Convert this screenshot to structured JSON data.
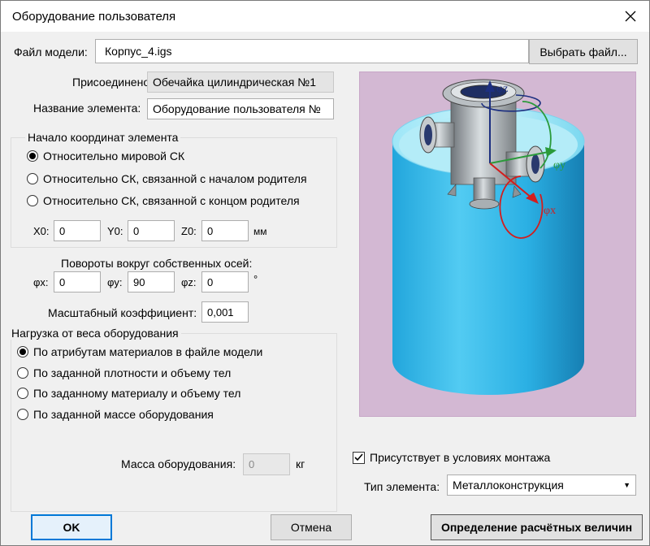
{
  "window": {
    "title": "Оборудование пользователя"
  },
  "model_file": {
    "label": "Файл модели:",
    "value": "Корпус_4.igs",
    "browse_button": "Выбрать файл..."
  },
  "attached_to": {
    "label": "Присоединено к:",
    "value": "Обечайка цилиндрическая №1"
  },
  "element_name": {
    "label": "Название элемента:",
    "value": "Оборудование пользователя №"
  },
  "origin": {
    "title": "Начало координат элемента",
    "options": [
      {
        "label": "Относительно мировой СК",
        "selected": true
      },
      {
        "label": "Относительно СК, связанной с началом родителя",
        "selected": false
      },
      {
        "label": "Относительно СК, связанной с концом родителя",
        "selected": false
      }
    ],
    "x_label": "X0:",
    "x_value": "0",
    "y_label": "Y0:",
    "y_value": "0",
    "z_label": "Z0:",
    "z_value": "0",
    "unit": "мм"
  },
  "rotation": {
    "title": "Повороты вокруг собственных осей:",
    "x_label": "φx:",
    "x_value": "0",
    "y_label": "φy:",
    "y_value": "90",
    "z_label": "φz:",
    "z_value": "0",
    "unit": "°"
  },
  "scale": {
    "label": "Масштабный коэффициент:",
    "value": "0,001"
  },
  "weight": {
    "title": "Нагрузка от веса оборудования",
    "options": [
      {
        "label": "По атрибутам материалов в файле модели",
        "selected": true
      },
      {
        "label": "По заданной плотности и объему тел",
        "selected": false
      },
      {
        "label": "По заданному материалу и объему тел",
        "selected": false
      },
      {
        "label": "По заданной массе оборудования",
        "selected": false
      }
    ],
    "mass_label": "Масса оборудования:",
    "mass_value": "0",
    "mass_unit": "кг"
  },
  "preview": {
    "axis_z": "φz",
    "axis_y": "φy",
    "axis_x": "φx"
  },
  "mounting": {
    "label": "Присутствует в условиях монтажа",
    "checked": true
  },
  "element_type": {
    "label": "Тип элемента:",
    "value": "Металлоконструкция"
  },
  "buttons": {
    "ok": "OK",
    "cancel": "Отмена",
    "calc": "Определение расчётных величин"
  }
}
